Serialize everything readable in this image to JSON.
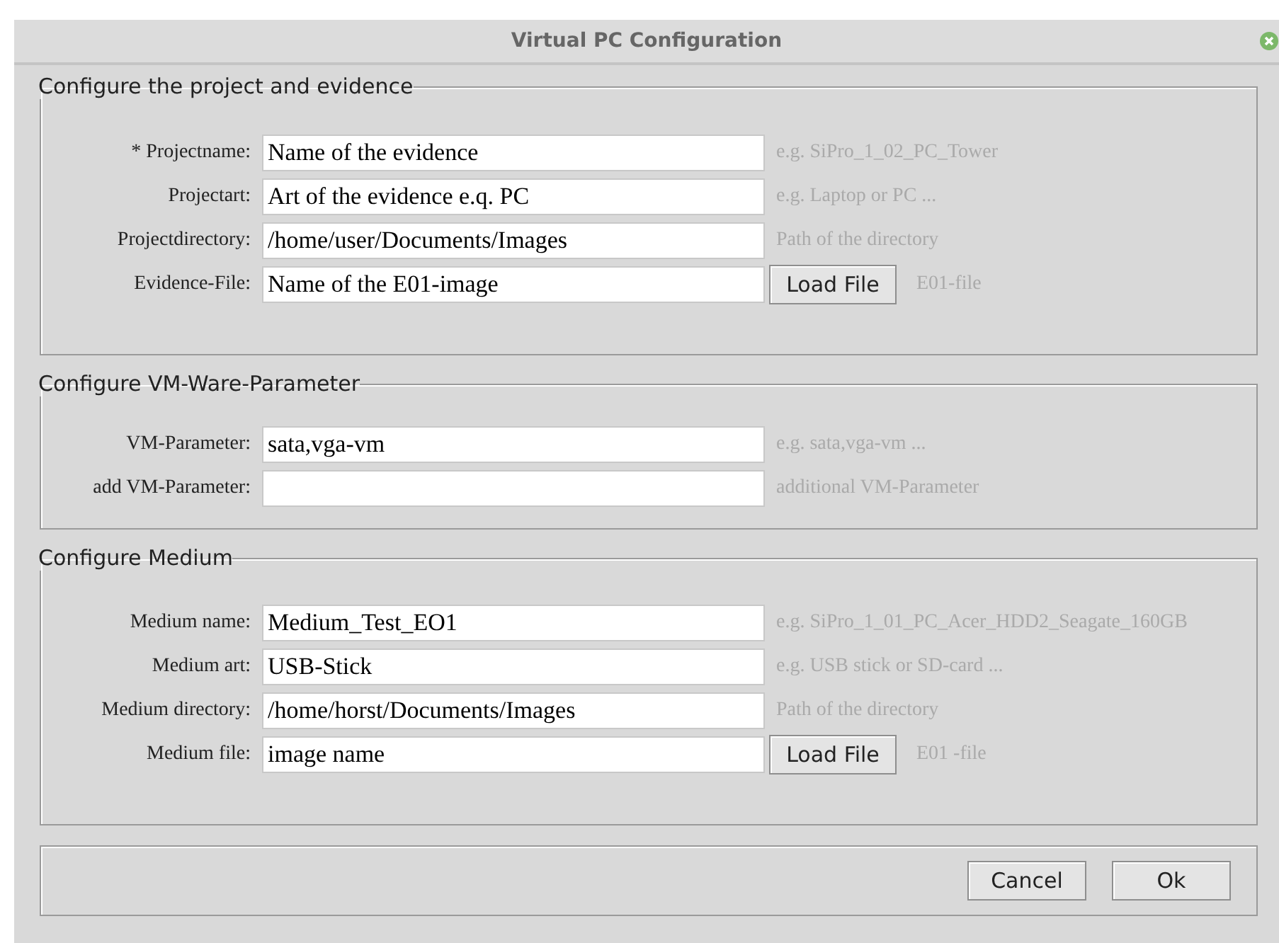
{
  "window": {
    "title": "Virtual PC Configuration"
  },
  "sections": [
    {
      "title": "Configure the project and evidence",
      "rows": [
        {
          "label": "* Projectname:",
          "value": "Name of the evidence",
          "hint": "e.g. SiPro_1_02_PC_Tower"
        },
        {
          "label": "Projectart:",
          "value": "Art of the evidence e.q. PC",
          "hint": "e.g. Laptop or PC ..."
        },
        {
          "label": "Projectdirectory:",
          "value": "/home/user/Documents/Images",
          "hint": "Path of the directory"
        },
        {
          "label": "Evidence-File:",
          "value": "Name of the E01-image",
          "button": "Load File",
          "hint": "E01-file"
        }
      ]
    },
    {
      "title": "Configure VM-Ware-Parameter",
      "rows": [
        {
          "label": "VM-Parameter:",
          "value": "sata,vga-vm",
          "hint": "e.g. sata,vga-vm ..."
        },
        {
          "label": "add VM-Parameter:",
          "hint": "additional VM-Parameter"
        }
      ]
    },
    {
      "title": "Configure Medium",
      "rows": [
        {
          "label": "Medium name:",
          "value": "Medium_Test_EO1",
          "hint": "e.g. SiPro_1_01_PC_Acer_HDD2_Seagate_160GB"
        },
        {
          "label": "Medium art:",
          "value": "USB-Stick",
          "hint": "e.g. USB stick or SD-card ..."
        },
        {
          "label": "Medium directory:",
          "value": "/home/horst/Documents/Images",
          "hint": "Path of the directory"
        },
        {
          "label": "Medium file:",
          "value": "image name",
          "button": "Load File",
          "hint": "E01 -file"
        }
      ]
    }
  ],
  "buttons": [
    "Cancel",
    "Ok"
  ]
}
